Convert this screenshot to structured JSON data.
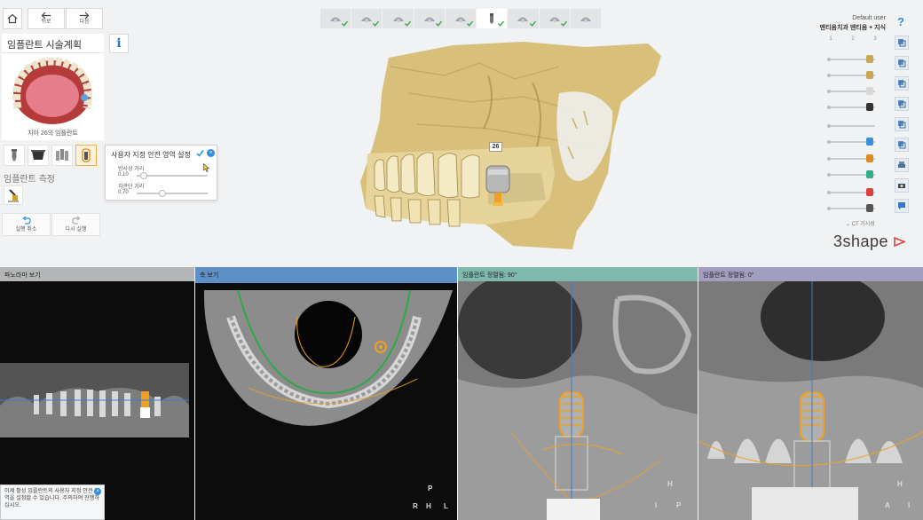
{
  "nav": {
    "back_label": "뒤로",
    "forward_label": "다음"
  },
  "left_panel": {
    "title": "임플란트 시술계획",
    "thumbnail_caption": "치아 26의 임플란트",
    "measure_label": "임플란트 측정",
    "undo_label": "실행 취소",
    "redo_label": "다시 실행"
  },
  "safety_popup": {
    "title": "사용자 지정 안전 영역 설정",
    "sliders": [
      {
        "label": "방사상 거리",
        "value": "0.10",
        "level": 0.05
      },
      {
        "label": "치관단 거리",
        "value": "0.70",
        "level": 0.35
      }
    ]
  },
  "workflow": {
    "steps": [
      "step-1-icon",
      "step-2-icon",
      "step-3-icon",
      "step-4-icon",
      "step-5-icon",
      "step-6-implant-icon",
      "step-7-icon",
      "step-8-icon",
      "step-9-icon"
    ],
    "active_index": 5
  },
  "right_panel": {
    "user": "Default user",
    "profile": "덴티움치과 덴티움 + 지식",
    "column_headers": [
      "1",
      "2",
      "3"
    ],
    "ct_visibility_label": "CT 가시성",
    "brand": "3shape"
  },
  "view3d": {
    "tooth_tag": "26"
  },
  "views": [
    {
      "title": "파노라마 보기"
    },
    {
      "title": "축 보기"
    },
    {
      "title": "임플란트 정렬됨: 90°"
    },
    {
      "title": "임플란트 정렬됨: 0°"
    }
  ],
  "orientation": {
    "axial": {
      "top": "P",
      "left": "R",
      "right": "L",
      "center": "H"
    },
    "sagittal": {
      "top": "H",
      "left": "I",
      "right": "P"
    },
    "coronal": {
      "top": "H",
      "left": "A",
      "right": "I"
    }
  },
  "notice": {
    "text": "이제 활성 임플란트의 사용자 지정 안전 영역을 설정할 수 있습니다. 주의하여 진행하십시오."
  },
  "colors": {
    "accent": "#2f8ee0",
    "implant": "#f0a020",
    "bone": "#d8c07a",
    "brand_red": "#d9433a"
  }
}
